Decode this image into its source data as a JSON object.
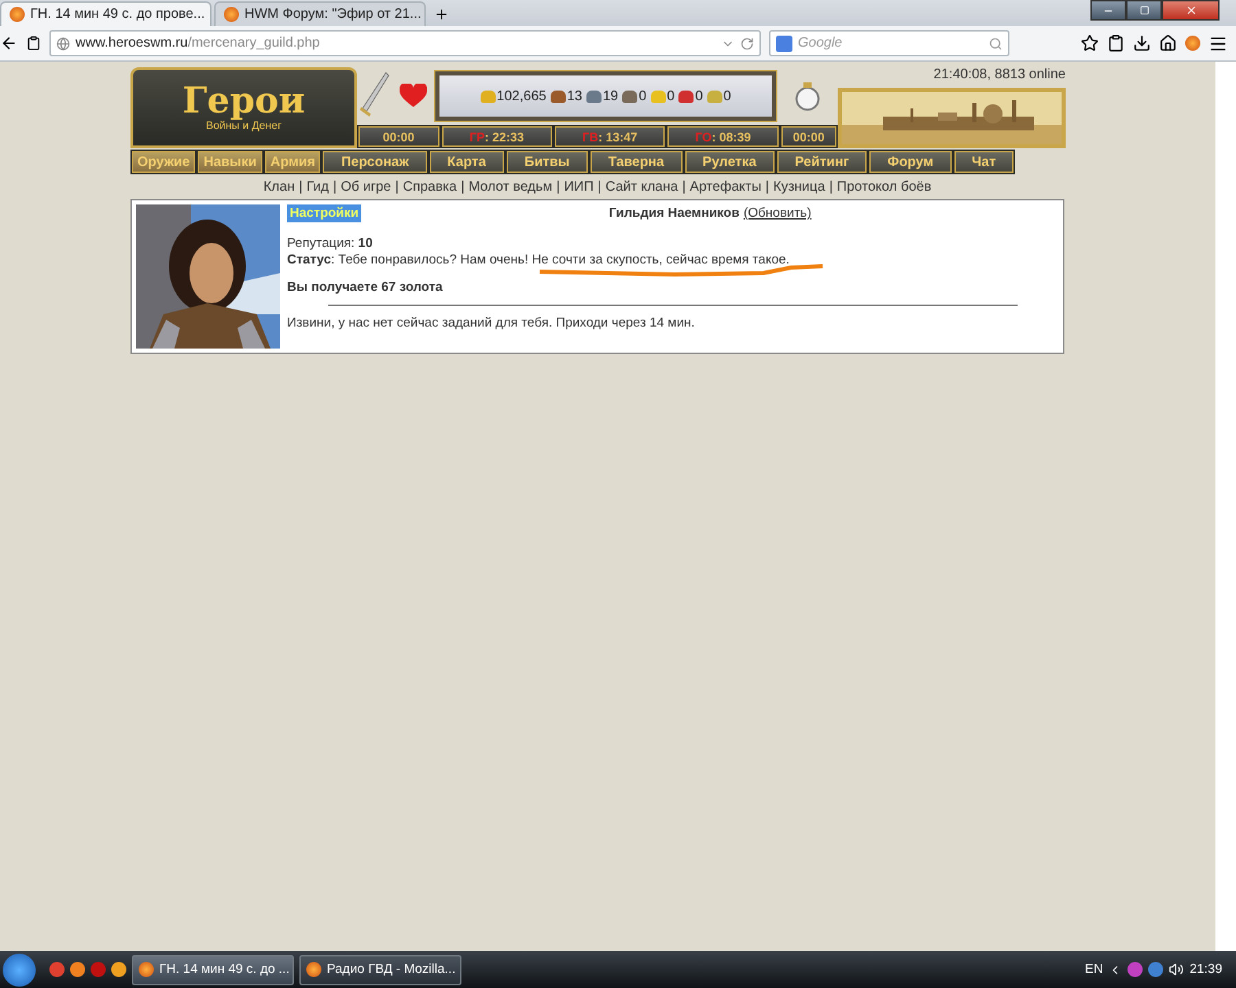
{
  "browser": {
    "tabs": [
      {
        "title": "ГН. 14 мин 49 с. до прове...",
        "selected": true
      },
      {
        "title": "HWM Форум: \"Эфир от 21...",
        "selected": false
      }
    ],
    "url_host": "www.heroeswm.ru",
    "url_path": "/mercenary_guild.php",
    "search_placeholder": "Google"
  },
  "header": {
    "logo_title": "Герои",
    "logo_subtitle": "Войны и Денег",
    "clock": "21:40:08, 8813 online",
    "resources": [
      {
        "value": "102,665",
        "color": "#e0b020"
      },
      {
        "value": "13",
        "color": "#9a5a2a"
      },
      {
        "value": "19",
        "color": "#6a7a8a"
      },
      {
        "value": "0",
        "color": "#7a6a5a"
      },
      {
        "value": "0",
        "color": "#e8c020"
      },
      {
        "value": "0",
        "color": "#d03030"
      },
      {
        "value": "0",
        "color": "#c8b040"
      }
    ],
    "timers": [
      {
        "value": "00:00"
      },
      {
        "label": "ГР",
        "sep": ":",
        "value": "22:33"
      },
      {
        "label": "ГВ",
        "sep": ":",
        "value": "13:47"
      },
      {
        "label": "ГО",
        "sep": ":",
        "value": "08:39"
      },
      {
        "value": "00:00"
      }
    ]
  },
  "nav": [
    {
      "label": "Оружие",
      "kind": "side"
    },
    {
      "label": "Навыки",
      "kind": "side"
    },
    {
      "label": "Армия",
      "kind": "side"
    },
    {
      "label": "Персонаж",
      "kind": "main"
    },
    {
      "label": "Карта",
      "kind": "main"
    },
    {
      "label": "Битвы",
      "kind": "main"
    },
    {
      "label": "Таверна",
      "kind": "main"
    },
    {
      "label": "Рулетка",
      "kind": "main"
    },
    {
      "label": "Рейтинг",
      "kind": "main"
    },
    {
      "label": "Форум",
      "kind": "main"
    },
    {
      "label": "Чат",
      "kind": "main"
    }
  ],
  "links": [
    {
      "label": "Клан"
    },
    {
      "sep": "|",
      "label": "Гид"
    },
    {
      "sep": "|",
      "label": "Об игре"
    },
    {
      "sep": "|",
      "label": "Справка"
    },
    {
      "sep": "|",
      "label": "Молот ведьм"
    },
    {
      "sep": "|",
      "label": "ИИП"
    },
    {
      "sep": "|",
      "label": "Сайт клана"
    },
    {
      "sep": "|",
      "label": "Артефакты"
    },
    {
      "sep": "|",
      "label": "Кузница"
    },
    {
      "sep": "|",
      "label": "Протокол боёв"
    }
  ],
  "guild": {
    "settings": "Настройки",
    "title": "Гильдия Наемников",
    "refresh": "(Обновить)",
    "reputation": "Репутация: **10**",
    "status": "**Статус**: Тебе понравилось? Нам очень! Не сочти за скупость, сейчас время такое.",
    "reward": "Вы получаете 67 золота",
    "message": "Извини, у нас нет сейчас заданий для тебя. Приходи через 14 мин."
  },
  "taskbar": {
    "windows": [
      {
        "title": "ГН. 14 мин 49 с. до ...",
        "selected": true
      },
      {
        "title": "Радио ГВД - Mozilla...",
        "selected": false
      }
    ],
    "lang": "EN",
    "time": "21:39"
  }
}
